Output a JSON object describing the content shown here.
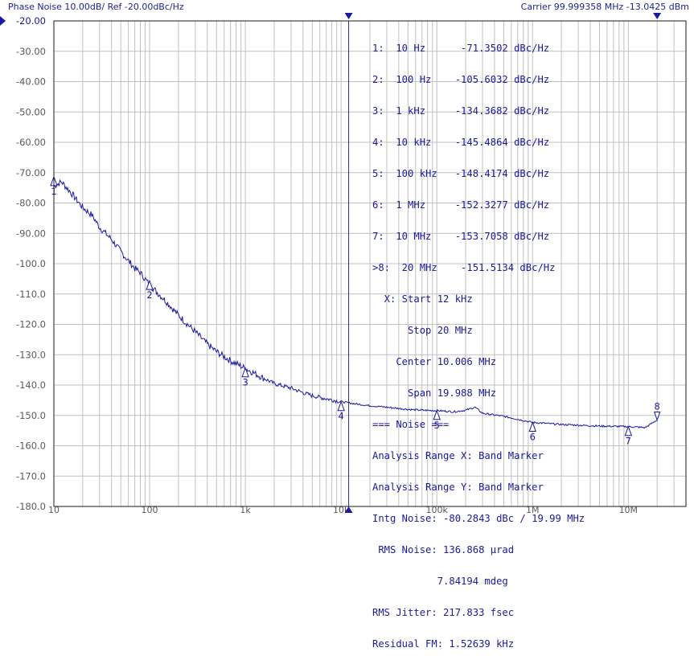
{
  "header": {
    "title": "Phase Noise 10.00dB/ Ref -20.00dBc/Hz",
    "carrier": "Carrier 99.999358 MHz   -13.0425 dBm"
  },
  "colors": {
    "trace": "#1a1aa0",
    "grid": "#c0c0c0",
    "axis_text": "#5a5a5a",
    "panel_text": "#1a1a9a",
    "active_marker_line": "#2a2a6a"
  },
  "chart_data": {
    "type": "line",
    "title": "Phase Noise 10.00dB/ Ref -20.00dBc/Hz",
    "xscale": "log",
    "xlim": [
      10,
      40000000
    ],
    "ylim": [
      -180,
      -20
    ],
    "grid": true,
    "y_ticks": [
      "-20.00",
      "-30.00",
      "-40.00",
      "-50.00",
      "-60.00",
      "-70.00",
      "-80.00",
      "-90.00",
      "-100.0",
      "-110.0",
      "-120.0",
      "-130.0",
      "-140.0",
      "-150.0",
      "-160.0",
      "-170.0",
      "-180.0"
    ],
    "x_tick_labels": [
      {
        "x": 10,
        "label": "10"
      },
      {
        "x": 100,
        "label": "100"
      },
      {
        "x": 1000,
        "label": "1k"
      },
      {
        "x": 10000,
        "label": "10k"
      },
      {
        "x": 100000,
        "label": "100k"
      },
      {
        "x": 1000000,
        "label": "1M"
      },
      {
        "x": 10000000,
        "label": "10M"
      }
    ],
    "series": [
      {
        "points": [
          [
            10,
            -74.5
          ],
          [
            12,
            -73.0
          ],
          [
            15,
            -76.5
          ],
          [
            20,
            -81.5
          ],
          [
            25,
            -84.0
          ],
          [
            30,
            -88.0
          ],
          [
            40,
            -92.0
          ],
          [
            50,
            -96.0
          ],
          [
            60,
            -99.0
          ],
          [
            70,
            -101.5
          ],
          [
            80,
            -103.0
          ],
          [
            100,
            -107.0
          ],
          [
            120,
            -109.5
          ],
          [
            150,
            -112.5
          ],
          [
            200,
            -117.0
          ],
          [
            300,
            -122.5
          ],
          [
            400,
            -126.5
          ],
          [
            500,
            -129.0
          ],
          [
            700,
            -132.0
          ],
          [
            1000,
            -134.5
          ],
          [
            1500,
            -137.5
          ],
          [
            2000,
            -139.5
          ],
          [
            3000,
            -141.0
          ],
          [
            4000,
            -142.5
          ],
          [
            5000,
            -143.5
          ],
          [
            7000,
            -144.5
          ],
          [
            10000,
            -145.5
          ],
          [
            15000,
            -146.3
          ],
          [
            20000,
            -146.8
          ],
          [
            30000,
            -147.3
          ],
          [
            50000,
            -148.0
          ],
          [
            70000,
            -148.3
          ],
          [
            100000,
            -148.4
          ],
          [
            150000,
            -148.8
          ],
          [
            200000,
            -148.3
          ],
          [
            250000,
            -147.3
          ],
          [
            300000,
            -149.3
          ],
          [
            500000,
            -150.3
          ],
          [
            1000000,
            -152.3
          ],
          [
            2000000,
            -153.0
          ],
          [
            5000000,
            -153.5
          ],
          [
            10000000,
            -153.7
          ],
          [
            15000000,
            -154.0
          ],
          [
            20000000,
            -151.5
          ]
        ]
      }
    ],
    "markers": [
      {
        "id": "1",
        "x": 10,
        "y": -71.3502
      },
      {
        "id": "2",
        "x": 100,
        "y": -105.6032
      },
      {
        "id": "3",
        "x": 1000,
        "y": -134.3682
      },
      {
        "id": "4",
        "x": 10000,
        "y": -145.4864
      },
      {
        "id": "5",
        "x": 100000,
        "y": -148.4174
      },
      {
        "id": "6",
        "x": 1000000,
        "y": -152.3277
      },
      {
        "id": "7",
        "x": 10000000,
        "y": -153.7058
      },
      {
        "id": "8",
        "x": 20000000,
        "y": -151.5134
      }
    ],
    "analysis_range": {
      "start": 12000,
      "stop": 20000000
    }
  },
  "marker_table": [
    "1:  10 Hz      -71.3502 dBc/Hz",
    "2:  100 Hz    -105.6032 dBc/Hz",
    "3:  1 kHz     -134.3682 dBc/Hz",
    "4:  10 kHz    -145.4864 dBc/Hz",
    "5:  100 kHz   -148.4174 dBc/Hz",
    "6:  1 MHz     -152.3277 dBc/Hz",
    "7:  10 MHz    -153.7058 dBc/Hz",
    ">8:  20 MHz    -151.5134 dBc/Hz"
  ],
  "range_panel": [
    "  X: Start 12 kHz",
    "      Stop 20 MHz",
    "    Center 10.006 MHz",
    "      Span 19.988 MHz"
  ],
  "noise_panel": [
    "=== Noise ===",
    "Analysis Range X: Band Marker",
    "Analysis Range Y: Band Marker",
    "Intg Noise: -80.2843 dBc / 19.99 MHz",
    " RMS Noise: 136.868 µrad",
    "           7.84194 mdeg",
    "RMS Jitter: 217.833 fsec",
    "Residual FM: 1.52639 kHz"
  ]
}
